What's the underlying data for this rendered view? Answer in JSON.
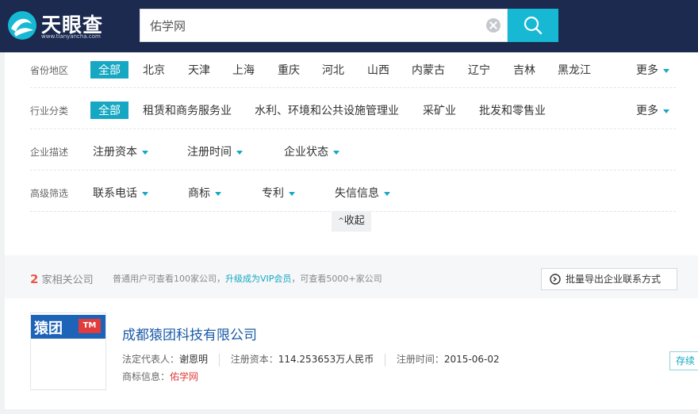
{
  "header": {
    "logo_text": "天眼查",
    "logo_sub": "www.tianyancha.com",
    "search_value": "佑学网"
  },
  "filters": {
    "region": {
      "label": "省份地区",
      "selected": "全部",
      "options": [
        "北京",
        "天津",
        "上海",
        "重庆",
        "河北",
        "山西",
        "内蒙古",
        "辽宁",
        "吉林",
        "黑龙江"
      ],
      "more": "更多"
    },
    "industry": {
      "label": "行业分类",
      "selected": "全部",
      "options": [
        "租赁和商务服务业",
        "水利、环境和公共设施管理业",
        "采矿业",
        "批发和零售业"
      ],
      "more": "更多"
    },
    "desc": {
      "label": "企业描述",
      "dropdowns": [
        "注册资本",
        "注册时间",
        "企业状态"
      ]
    },
    "advanced": {
      "label": "高级筛选",
      "dropdowns": [
        "联系电话",
        "商标",
        "专利",
        "失信信息"
      ]
    },
    "collapse": "收起"
  },
  "results": {
    "count": "2",
    "count_suffix": "家相关公司",
    "hint_a": "普通用户可查看100家公司，",
    "hint_link": "升级成为VIP会员",
    "hint_b": "，可查看5000+家公司",
    "export_label": "批量导出企业联系方式"
  },
  "company": {
    "logo_cn": "猿团",
    "logo_tm": "TM",
    "name": "成都猿团科技有限公司",
    "legal_label": "法定代表人：",
    "legal_value": "谢恩明",
    "capital_label": "注册资本：",
    "capital_value": "114.253653万人民币",
    "date_label": "注册时间：",
    "date_value": "2015-06-02",
    "trademark_label": "商标信息：",
    "trademark_value": "佑学网",
    "status": "存续"
  },
  "colors": {
    "brand": "#16b8d3",
    "header_bg": "#1b2a4e",
    "link": "#1a5aa6",
    "accent_red": "#e23b3b"
  }
}
